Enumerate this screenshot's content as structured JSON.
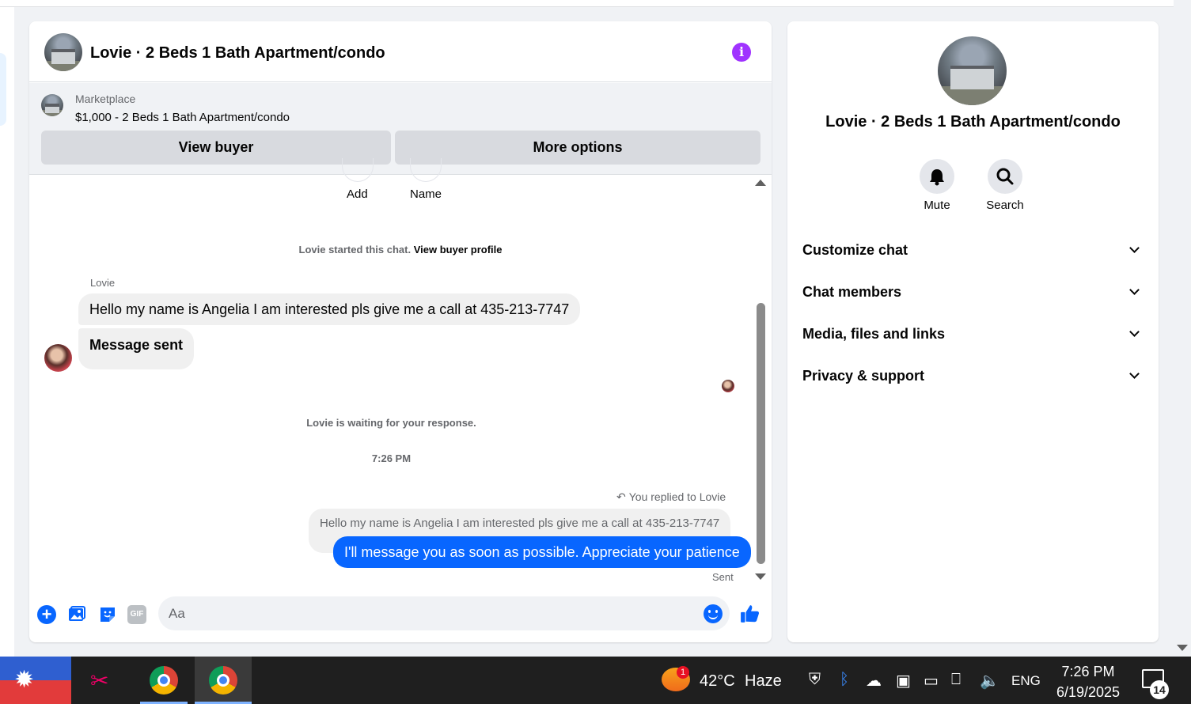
{
  "chat": {
    "title": "Lovie · 2 Beds 1 Bath Apartment/condo",
    "marketplace_label": "Marketplace",
    "listing": "$1,000 - 2 Beds 1 Bath Apartment/condo",
    "view_buyer": "View buyer",
    "more_options": "More options",
    "add_label": "Add",
    "name_label": "Name",
    "started_text": "Lovie started this chat.",
    "view_profile": "View buyer profile",
    "sender": "Lovie",
    "msg1": "Hello my name is Angelia I am interested pls give me a call at 435-213-7747",
    "msg2": "Message sent",
    "waiting": "Lovie is waiting for your response.",
    "time": "7:26 PM",
    "replied_to": "You replied to Lovie",
    "quote": "Hello my name is Angelia I am interested pls give me a call at 435-213-7747",
    "reply": "I'll message you as soon as possible. Appreciate your patience",
    "sent": "Sent",
    "input_placeholder": "Aa",
    "gif": "GIF"
  },
  "info": {
    "title": "Lovie · 2 Beds 1 Bath Apartment/condo",
    "mute": "Mute",
    "search": "Search",
    "sections": [
      "Customize chat",
      "Chat members",
      "Media, files and links",
      "Privacy & support"
    ]
  },
  "taskbar": {
    "weather_badge": "1",
    "temperature": "42°C",
    "condition": "Haze",
    "language": "ENG",
    "time": "7:26 PM",
    "date": "6/19/2025",
    "notifications": "14"
  },
  "colors": {
    "accent": "#0866ff",
    "info": "#a033ff",
    "bubble_in": "#f0f0f0"
  }
}
